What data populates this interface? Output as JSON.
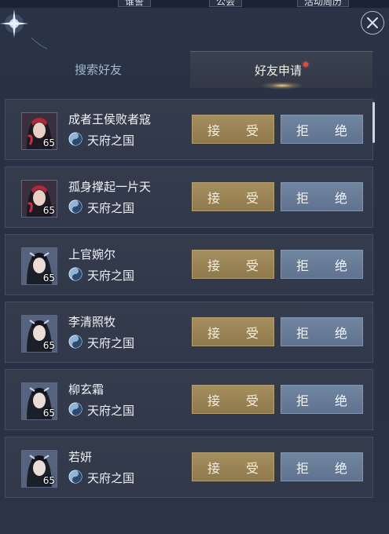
{
  "top_tabs": [
    "谁誓",
    "公会",
    "活动周历"
  ],
  "tabs": {
    "search": "搜索好友",
    "apply": "好友申请",
    "apply_has_notice": true
  },
  "close_icon": "close-icon",
  "requests": [
    {
      "name": "成者王侯败者寇",
      "level": "65",
      "server": "天府之国",
      "accept": "接 受",
      "reject": "拒 绝",
      "avatar": "portrait-red"
    },
    {
      "name": "孤身撑起一片天",
      "level": "65",
      "server": "天府之国",
      "accept": "接 受",
      "reject": "拒 绝",
      "avatar": "portrait-red"
    },
    {
      "name": "上官婉尔",
      "level": "65",
      "server": "天府之国",
      "accept": "接 受",
      "reject": "拒 绝",
      "avatar": "portrait-blue"
    },
    {
      "name": "李清照牧",
      "level": "65",
      "server": "天府之国",
      "accept": "接 受",
      "reject": "拒 绝",
      "avatar": "portrait-blue"
    },
    {
      "name": "柳玄霜",
      "level": "65",
      "server": "天府之国",
      "accept": "接 受",
      "reject": "拒 绝",
      "avatar": "portrait-blue"
    },
    {
      "name": "若妍",
      "level": "65",
      "server": "天府之国",
      "accept": "接 受",
      "reject": "拒 绝",
      "avatar": "portrait-blue"
    }
  ],
  "colors": {
    "accept": "#9b875a",
    "reject": "#6a7e9a",
    "notice_dot": "#e34b4b"
  }
}
